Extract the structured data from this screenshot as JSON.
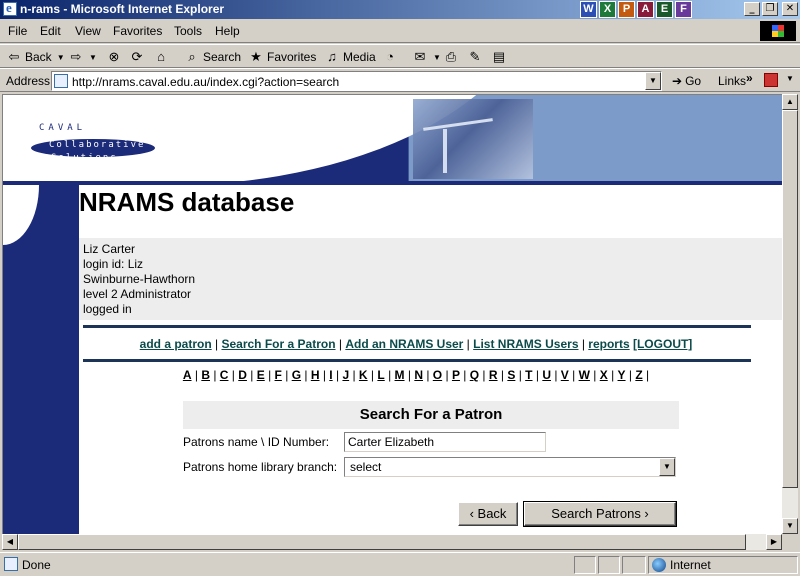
{
  "window": {
    "title": "n-rams - Microsoft Internet Explorer",
    "taskbar_apps": [
      {
        "icon": "w",
        "color": "#2b4fb3",
        "label": "W"
      },
      {
        "icon": "x",
        "color": "#1e7a3a",
        "label": "X"
      },
      {
        "icon": "p",
        "color": "#c45a10",
        "label": "P"
      },
      {
        "icon": "a",
        "color": "#8a1a3a",
        "label": "A"
      },
      {
        "icon": "e",
        "color": "#1a5a2a",
        "label": "E"
      },
      {
        "icon": "f",
        "color": "#6a3a9a",
        "label": "F"
      }
    ],
    "minimize": "_",
    "maximize": "❐",
    "close": "✕"
  },
  "menu": {
    "file": "File",
    "edit": "Edit",
    "view": "View",
    "favorites": "Favorites",
    "tools": "Tools",
    "help": "Help"
  },
  "toolbar": {
    "back": "Back",
    "search": "Search",
    "favorites": "Favorites",
    "media": "Media"
  },
  "address": {
    "label": "Address",
    "url": "http://nrams.caval.edu.au/index.cgi?action=search",
    "go": "Go",
    "links": "Links",
    "links_chevron": "»"
  },
  "banner": {
    "logo_top": "CAVAL",
    "logo_mid": "Collaborative",
    "logo_bot": "Solutions"
  },
  "page": {
    "title": "NRAMS database",
    "user": {
      "name": "Liz Carter",
      "login": "login id: Liz",
      "institution": "Swinburne-Hawthorn",
      "level": "level 2 Administrator",
      "status": "logged in"
    },
    "nav": {
      "add_patron": "add a patron",
      "search_patron": "Search For a Patron",
      "add_user": "Add an NRAMS User",
      "list_users": "List NRAMS Users",
      "reports": "reports",
      "logout": "[LOGOUT]",
      "sep": " | "
    },
    "alphabet": [
      "A",
      "B",
      "C",
      "D",
      "E",
      "F",
      "G",
      "H",
      "I",
      "J",
      "K",
      "L",
      "M",
      "N",
      "O",
      "P",
      "Q",
      "R",
      "S",
      "T",
      "U",
      "V",
      "W",
      "X",
      "Y",
      "Z"
    ],
    "form": {
      "header": "Search For a Patron",
      "name_label": "Patrons name \\ ID Number:",
      "name_value": "Carter Elizabeth",
      "branch_label": "Patrons home library branch:",
      "branch_value": "select",
      "back_button": "‹ Back",
      "search_button": "Search Patrons ›"
    }
  },
  "status": {
    "text": "Done",
    "zone": "Internet"
  }
}
